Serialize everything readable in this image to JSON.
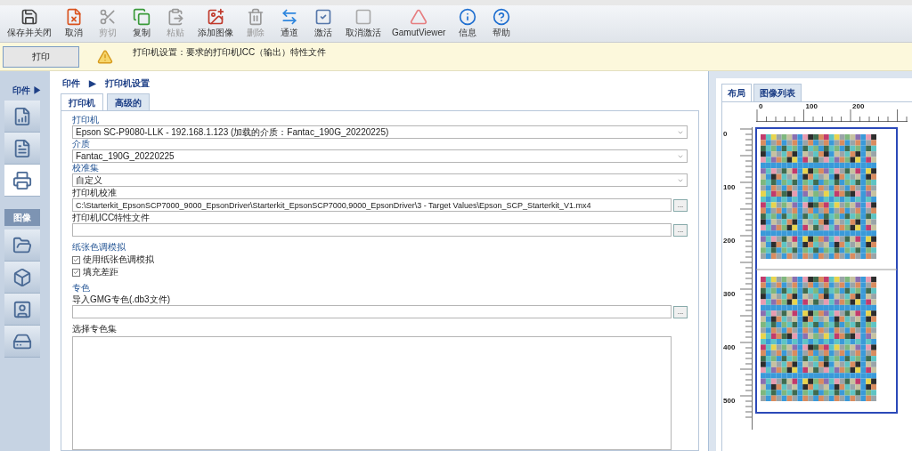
{
  "toolbar": [
    {
      "label": "保存并关闭",
      "disabled": false
    },
    {
      "label": "取消",
      "disabled": false
    },
    {
      "label": "剪切",
      "disabled": true
    },
    {
      "label": "复制",
      "disabled": false
    },
    {
      "label": "粘贴",
      "disabled": true
    },
    {
      "label": "添加图像",
      "disabled": false
    },
    {
      "label": "删除",
      "disabled": true
    },
    {
      "label": "通道",
      "disabled": false
    },
    {
      "label": "激活",
      "disabled": false
    },
    {
      "label": "取消激活",
      "disabled": false
    },
    {
      "label": "GamutViewer",
      "disabled": false
    },
    {
      "label": "信息",
      "disabled": false
    },
    {
      "label": "帮助",
      "disabled": false
    }
  ],
  "notice": {
    "button": "打印",
    "message": "打印机设置：要求的打印机ICC（输出）特性文件"
  },
  "sidebar": [
    {
      "title": "印件 ▶",
      "items": [
        {
          "selected": false
        },
        {
          "selected": false
        },
        {
          "selected": true
        }
      ]
    },
    {
      "title": "图像",
      "items": [
        {
          "selected": false
        },
        {
          "selected": false
        },
        {
          "selected": false
        },
        {
          "selected": false
        }
      ]
    }
  ],
  "breadcrumb": [
    "印件",
    "▶",
    "打印机设置"
  ],
  "tabs": [
    {
      "label": "打印机",
      "selected": true
    },
    {
      "label": "高级的",
      "selected": false
    }
  ],
  "form": [
    {
      "kind": "select",
      "label": "打印机",
      "value": "Epson SC-P9080-LLK - 192.168.1.123 (加载的介质：Fantac_190G_20220225)"
    },
    {
      "kind": "select",
      "label": "介质",
      "value": "Fantac_190G_20220225"
    },
    {
      "kind": "select",
      "label": "校准集",
      "value": "自定义"
    },
    {
      "kind": "file",
      "label": "打印机校准",
      "value": "C:\\Starterkit_EpsonSCP7000_9000_EpsonDriver\\Starterkit_EpsonSCP7000,9000_EpsonDriver\\3 - Target Values\\Epson_SCP_Starterkit_V1.mx4",
      "button": "..."
    },
    {
      "kind": "file",
      "label": "打印机ICC特性文件",
      "button": "..."
    },
    {
      "kind": "heading",
      "label": "纸张色调模拟"
    },
    {
      "kind": "checkbox",
      "label": "使用纸张色调模拟",
      "checked": true
    },
    {
      "kind": "checkbox",
      "label": "填充差距",
      "checked": true
    },
    {
      "kind": "heading",
      "label": "专色"
    },
    {
      "kind": "file",
      "label": "导入GMG专色(.db3文件)",
      "button": "..."
    },
    {
      "kind": "list",
      "label": "选择专色集"
    }
  ],
  "preview": {
    "tabs": [
      {
        "label": "布局",
        "selected": true
      },
      {
        "label": "图像列表",
        "selected": false
      }
    ],
    "hruler": [
      "0",
      "100",
      "200"
    ],
    "vruler": [
      "0",
      "100",
      "200",
      "300",
      "400",
      "500"
    ]
  }
}
